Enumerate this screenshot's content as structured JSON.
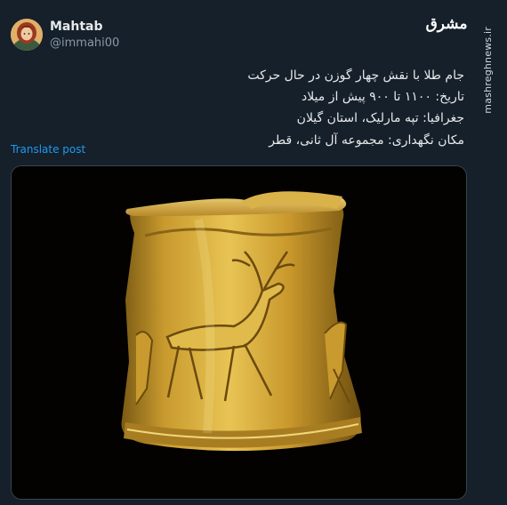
{
  "author": {
    "name": "Mahtab",
    "handle": "@immahi00"
  },
  "brand_logo": "مشرق",
  "tweet_lines": [
    "جام طلا با نقش چهار گوزن در حال حرکت",
    "تاریخ: ۱۱۰۰ تا ۹۰۰ پیش از میلاد",
    "جغرافیا: تپه مارلیک، استان گیلان",
    "مکان نگهداری: مجموعه آل ثانی، قطر"
  ],
  "translate_label": "Translate post",
  "side_watermark": "mashreghnews.ir",
  "colors": {
    "background": "#15202b",
    "link": "#1d9bf0",
    "secondary": "#8b98a5",
    "gold": "#c99a2e"
  },
  "media": {
    "icon": "gold-cup-photo"
  }
}
